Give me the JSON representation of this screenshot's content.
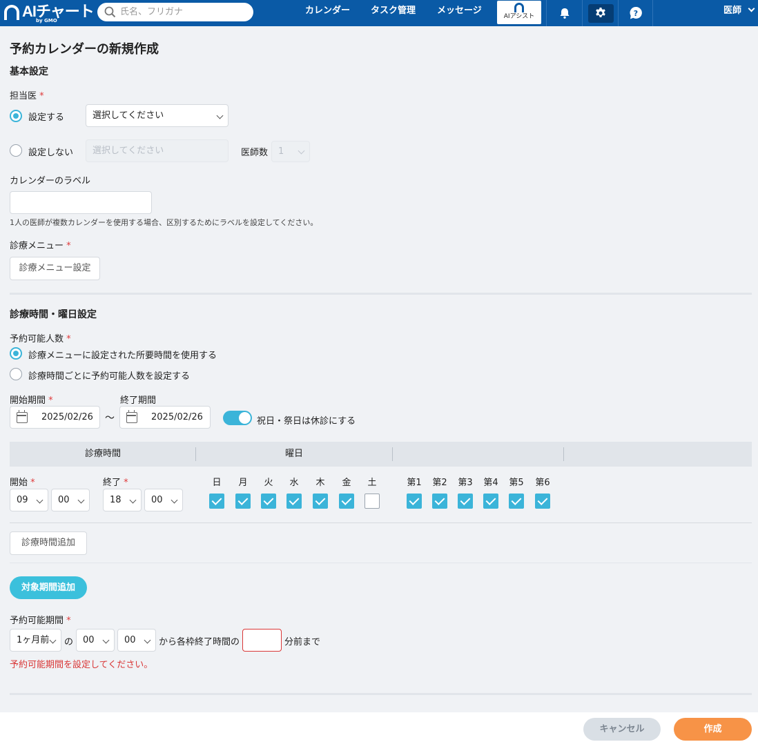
{
  "header": {
    "logo_text": "AIチャート",
    "logo_sub": "by GMO",
    "search_placeholder": "氏名、フリガナ",
    "nav": [
      "カレンダー",
      "タスク管理",
      "メッセージ"
    ],
    "ai_assist_label": "AIアシスト",
    "user_label": "医師",
    "icons": [
      "bell-icon",
      "gear-icon",
      "help-icon"
    ]
  },
  "page": {
    "title": "予約カレンダーの新規作成"
  },
  "basic": {
    "section_title": "基本設定",
    "doctor_label": "担当医",
    "required_mark": "*",
    "set_option": "設定する",
    "set_select_value": "選択してください",
    "unset_option": "設定しない",
    "unset_select_value": "選択してください",
    "doctor_count_label": "医師数",
    "doctor_count_value": "1",
    "calendar_label_title": "カレンダーのラベル",
    "calendar_label_value": "",
    "calendar_label_hint": "1人の医師が複数カレンダーを使用する場合、区別するためにラベルを設定してください。",
    "menu_label": "診療メニュー",
    "menu_button": "診療メニュー設定"
  },
  "schedule": {
    "section_title": "診療時間・曜日設定",
    "capacity_label": "予約可能人数",
    "capacity_option1": "診療メニューに設定された所要時間を使用する",
    "capacity_option2": "診療時間ごとに予約可能人数を設定する",
    "start_period_label": "開始期間",
    "end_period_label": "終了期間",
    "start_date": "2025/02/26",
    "tilde": "〜",
    "end_date": "2025/02/26",
    "holiday_toggle_label": "祝日・祭日は休診にする",
    "holiday_toggle_on": true,
    "table_head_time": "診療時間",
    "table_head_weekday": "曜日",
    "start_label": "開始",
    "end_label": "終了",
    "start_hour": "09",
    "start_min": "00",
    "end_hour": "18",
    "end_min": "00",
    "days": [
      {
        "label": "日",
        "checked": true
      },
      {
        "label": "月",
        "checked": true
      },
      {
        "label": "火",
        "checked": true
      },
      {
        "label": "水",
        "checked": true
      },
      {
        "label": "木",
        "checked": true
      },
      {
        "label": "金",
        "checked": true
      },
      {
        "label": "土",
        "checked": false
      }
    ],
    "weeks": [
      {
        "label": "第1",
        "checked": true
      },
      {
        "label": "第2",
        "checked": true
      },
      {
        "label": "第3",
        "checked": true
      },
      {
        "label": "第4",
        "checked": true
      },
      {
        "label": "第5",
        "checked": true
      },
      {
        "label": "第6",
        "checked": true
      }
    ],
    "add_time_button": "診療時間追加",
    "add_period_button": "対象期間追加"
  },
  "booking": {
    "label": "予約可能期間",
    "month_value": "1ヶ月前",
    "of_text": "の",
    "hour_value": "00",
    "min_value": "00",
    "from_text": "から各枠終了時間の",
    "minutes_value": "",
    "until_text": "分前まで",
    "error_text": "予約可能期間を設定してください。"
  },
  "footer": {
    "cancel": "キャンセル",
    "create": "作成"
  },
  "colors": {
    "header": "#0a5aa6",
    "accent": "#3bb4d9",
    "required": "#e03b3b",
    "create_button": "#f79347",
    "cancel_button": "#d9dfe5"
  }
}
